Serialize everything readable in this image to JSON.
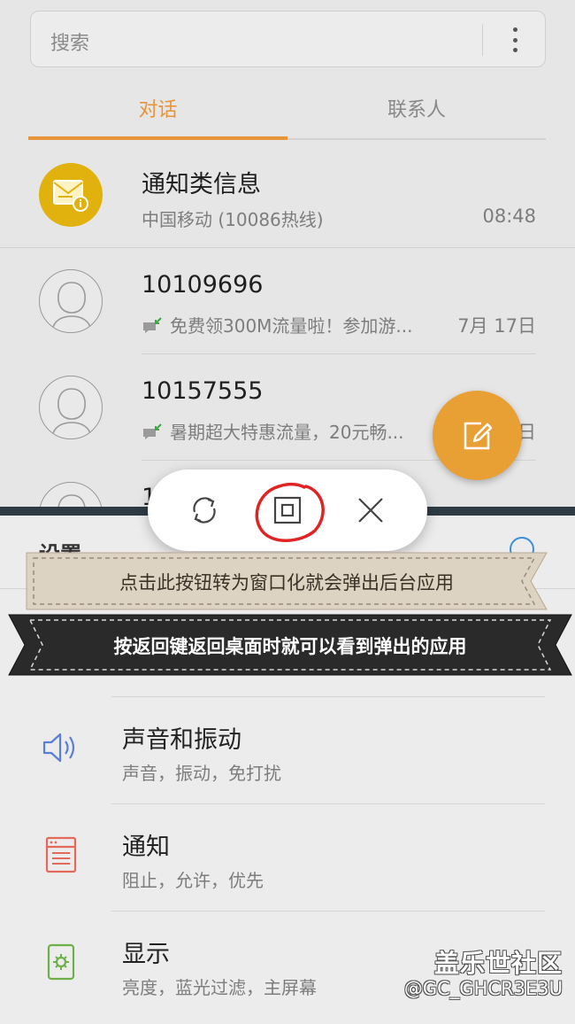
{
  "messages": {
    "search_placeholder": "搜索",
    "tabs": [
      {
        "label": "对话",
        "active": true
      },
      {
        "label": "联系人",
        "active": false
      }
    ],
    "conversations": [
      {
        "name": "通知类信息",
        "snippet": "中国移动 (10086热线)",
        "time": "08:48",
        "avatar": "notification-icon"
      },
      {
        "name": "10109696",
        "snippet": "免费领300M流量啦！参加游...",
        "time": "7月 17日",
        "avatar": "person-icon"
      },
      {
        "name": "10157555",
        "snippet": "暑期超大特惠流量，20元畅...",
        "time": "日",
        "avatar": "person-icon"
      },
      {
        "name": "1",
        "snippet": "",
        "time": "",
        "avatar": "person-icon"
      }
    ],
    "accent_color": "#e8953a"
  },
  "window_controls": {
    "icons": [
      "rotate-icon",
      "window-icon",
      "close-icon"
    ]
  },
  "tutorial": {
    "tip_1": "点击此按钮转为窗口化就会弹出后台应用",
    "tip_2": "按返回键返回桌面时就可以看到弹出的应用"
  },
  "settings": {
    "title": "设置",
    "items": [
      {
        "title": "声音和振动",
        "subtitle": "声音，振动，免打扰",
        "icon": "speaker-icon",
        "color": "#5b7ed6"
      },
      {
        "title": "通知",
        "subtitle": "阻止，允许，优先",
        "icon": "notification-list-icon",
        "color": "#e36a5a"
      },
      {
        "title": "显示",
        "subtitle": "亮度，蓝光过滤，主屏幕",
        "icon": "display-settings-icon",
        "color": "#6db04a"
      }
    ]
  },
  "watermark": {
    "title": "盖乐世社区",
    "user": "@GC_GHCR3E3U"
  }
}
